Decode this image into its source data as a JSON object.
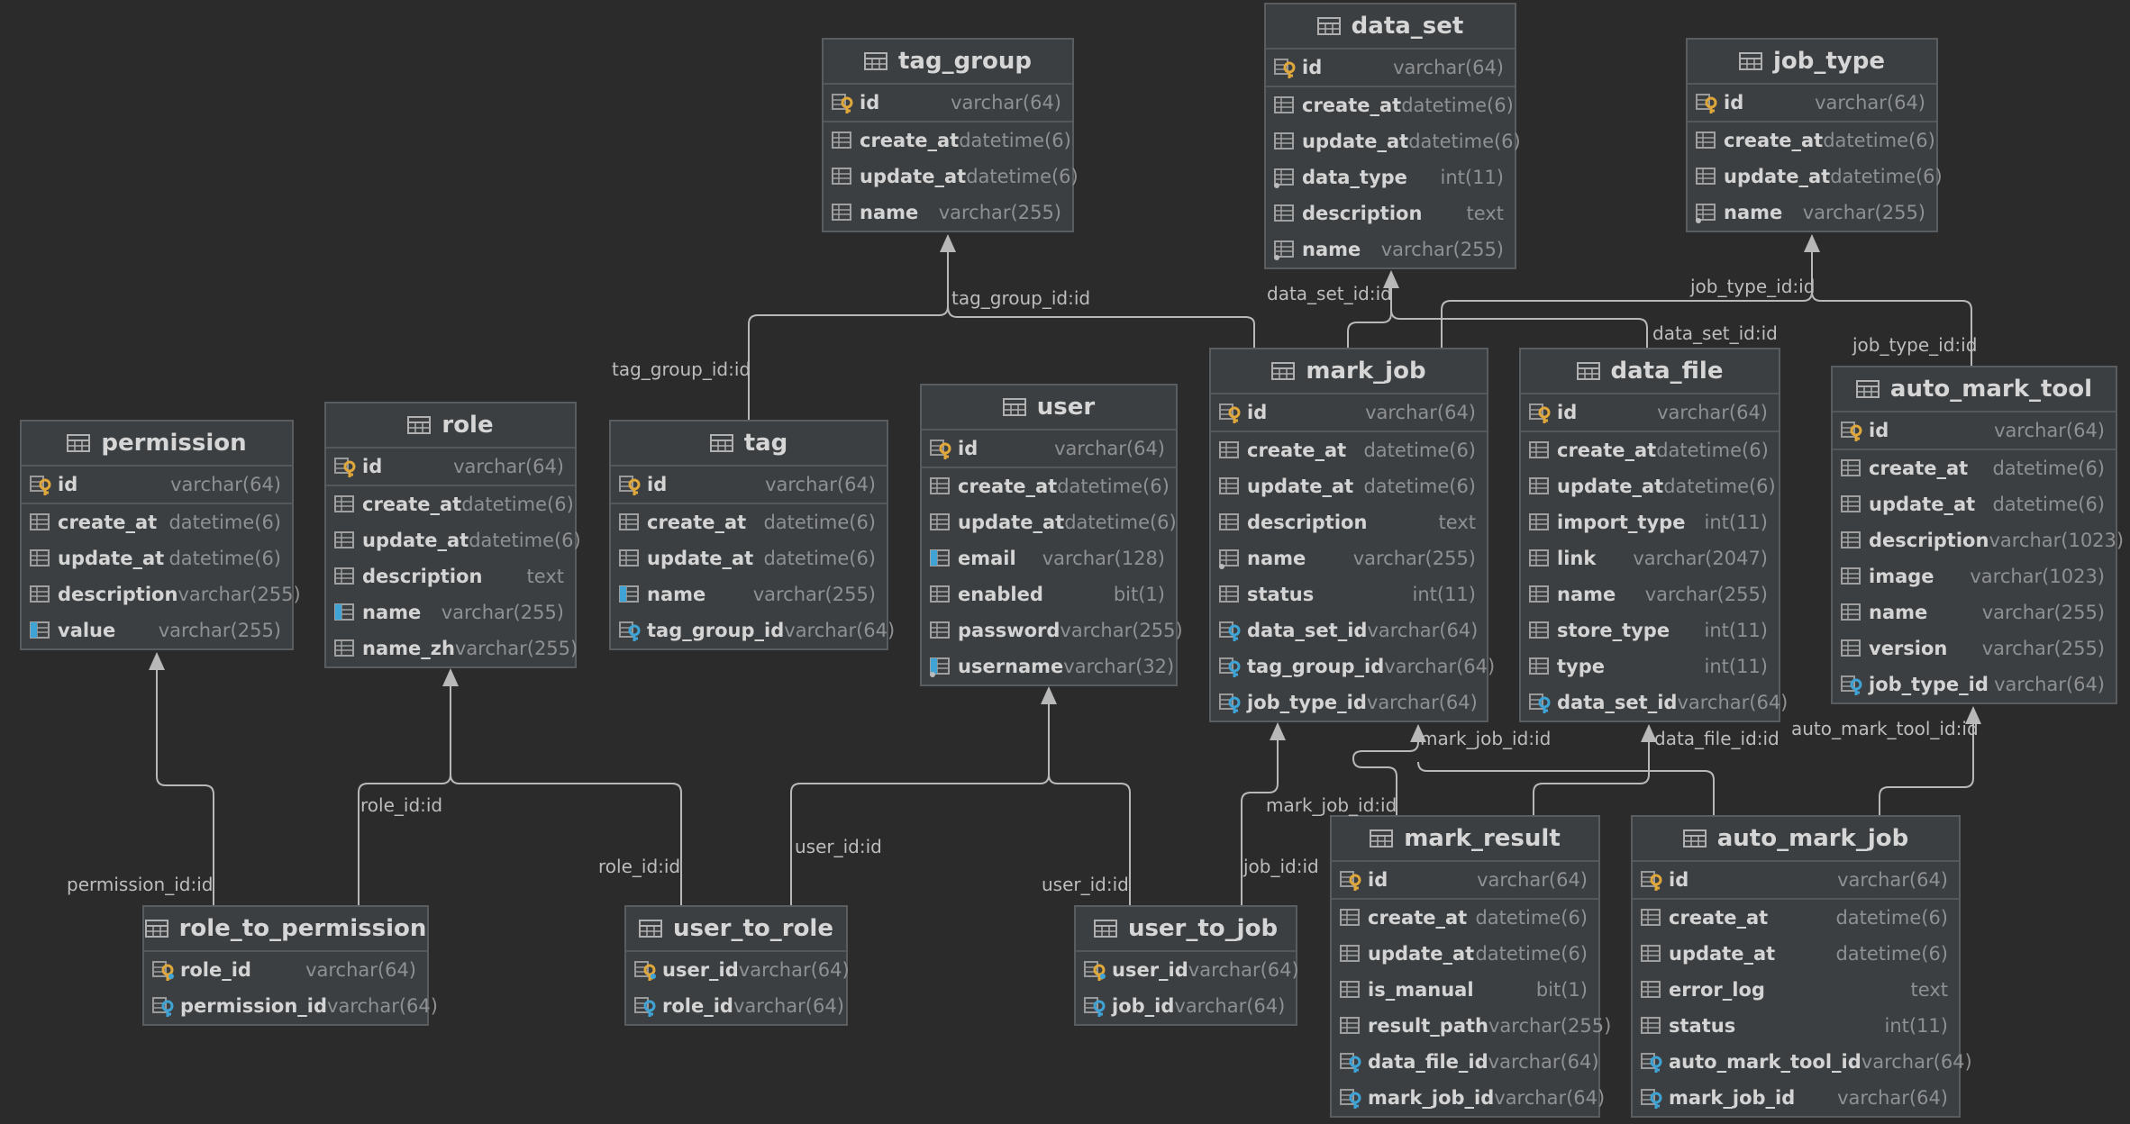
{
  "colors": {
    "background": "#2b2b2b",
    "table_bg": "#3c3f41",
    "table_border": "#5a5d60",
    "key_yellow": "#e0a83b",
    "key_blue": "#3fa3d6",
    "line": "#b8b8b8"
  },
  "tables": [
    {
      "name": "tag_group",
      "columns": [
        {
          "name": "id",
          "type": "varchar(64)",
          "kind": "pk"
        },
        {
          "name": "create_at",
          "type": "datetime(6)",
          "kind": "col"
        },
        {
          "name": "update_at",
          "type": "datetime(6)",
          "kind": "col"
        },
        {
          "name": "name",
          "type": "varchar(255)",
          "kind": "col"
        }
      ]
    },
    {
      "name": "data_set",
      "columns": [
        {
          "name": "id",
          "type": "varchar(64)",
          "kind": "pk"
        },
        {
          "name": "create_at",
          "type": "datetime(6)",
          "kind": "col"
        },
        {
          "name": "update_at",
          "type": "datetime(6)",
          "kind": "col"
        },
        {
          "name": "data_type",
          "type": "int(11)",
          "kind": "col-null"
        },
        {
          "name": "description",
          "type": "text",
          "kind": "col"
        },
        {
          "name": "name",
          "type": "varchar(255)",
          "kind": "col-null"
        }
      ]
    },
    {
      "name": "job_type",
      "columns": [
        {
          "name": "id",
          "type": "varchar(64)",
          "kind": "pk"
        },
        {
          "name": "create_at",
          "type": "datetime(6)",
          "kind": "col"
        },
        {
          "name": "update_at",
          "type": "datetime(6)",
          "kind": "col"
        },
        {
          "name": "name",
          "type": "varchar(255)",
          "kind": "col-null"
        }
      ]
    },
    {
      "name": "permission",
      "columns": [
        {
          "name": "id",
          "type": "varchar(64)",
          "kind": "pk"
        },
        {
          "name": "create_at",
          "type": "datetime(6)",
          "kind": "col"
        },
        {
          "name": "update_at",
          "type": "datetime(6)",
          "kind": "col"
        },
        {
          "name": "description",
          "type": "varchar(255)",
          "kind": "col"
        },
        {
          "name": "value",
          "type": "varchar(255)",
          "kind": "uniq"
        }
      ]
    },
    {
      "name": "role",
      "columns": [
        {
          "name": "id",
          "type": "varchar(64)",
          "kind": "pk"
        },
        {
          "name": "create_at",
          "type": "datetime(6)",
          "kind": "col"
        },
        {
          "name": "update_at",
          "type": "datetime(6)",
          "kind": "col"
        },
        {
          "name": "description",
          "type": "text",
          "kind": "col"
        },
        {
          "name": "name",
          "type": "varchar(255)",
          "kind": "uniq"
        },
        {
          "name": "name_zh",
          "type": "varchar(255)",
          "kind": "col"
        }
      ]
    },
    {
      "name": "tag",
      "columns": [
        {
          "name": "id",
          "type": "varchar(64)",
          "kind": "pk"
        },
        {
          "name": "create_at",
          "type": "datetime(6)",
          "kind": "col"
        },
        {
          "name": "update_at",
          "type": "datetime(6)",
          "kind": "col"
        },
        {
          "name": "name",
          "type": "varchar(255)",
          "kind": "uniq"
        },
        {
          "name": "tag_group_id",
          "type": "varchar(64)",
          "kind": "fk"
        }
      ]
    },
    {
      "name": "user",
      "columns": [
        {
          "name": "id",
          "type": "varchar(64)",
          "kind": "pk"
        },
        {
          "name": "create_at",
          "type": "datetime(6)",
          "kind": "col"
        },
        {
          "name": "update_at",
          "type": "datetime(6)",
          "kind": "col"
        },
        {
          "name": "email",
          "type": "varchar(128)",
          "kind": "uniq"
        },
        {
          "name": "enabled",
          "type": "bit(1)",
          "kind": "col"
        },
        {
          "name": "password",
          "type": "varchar(255)",
          "kind": "col"
        },
        {
          "name": "username",
          "type": "varchar(32)",
          "kind": "uniq-null"
        }
      ]
    },
    {
      "name": "mark_job",
      "columns": [
        {
          "name": "id",
          "type": "varchar(64)",
          "kind": "pk"
        },
        {
          "name": "create_at",
          "type": "datetime(6)",
          "kind": "col"
        },
        {
          "name": "update_at",
          "type": "datetime(6)",
          "kind": "col"
        },
        {
          "name": "description",
          "type": "text",
          "kind": "col"
        },
        {
          "name": "name",
          "type": "varchar(255)",
          "kind": "col-null"
        },
        {
          "name": "status",
          "type": "int(11)",
          "kind": "col"
        },
        {
          "name": "data_set_id",
          "type": "varchar(64)",
          "kind": "fk"
        },
        {
          "name": "tag_group_id",
          "type": "varchar(64)",
          "kind": "fk"
        },
        {
          "name": "job_type_id",
          "type": "varchar(64)",
          "kind": "fk"
        }
      ]
    },
    {
      "name": "data_file",
      "columns": [
        {
          "name": "id",
          "type": "varchar(64)",
          "kind": "pk"
        },
        {
          "name": "create_at",
          "type": "datetime(6)",
          "kind": "col"
        },
        {
          "name": "update_at",
          "type": "datetime(6)",
          "kind": "col"
        },
        {
          "name": "import_type",
          "type": "int(11)",
          "kind": "col"
        },
        {
          "name": "link",
          "type": "varchar(2047)",
          "kind": "col"
        },
        {
          "name": "name",
          "type": "varchar(255)",
          "kind": "col"
        },
        {
          "name": "store_type",
          "type": "int(11)",
          "kind": "col"
        },
        {
          "name": "type",
          "type": "int(11)",
          "kind": "col"
        },
        {
          "name": "data_set_id",
          "type": "varchar(64)",
          "kind": "fk"
        }
      ]
    },
    {
      "name": "auto_mark_tool",
      "columns": [
        {
          "name": "id",
          "type": "varchar(64)",
          "kind": "pk"
        },
        {
          "name": "create_at",
          "type": "datetime(6)",
          "kind": "col"
        },
        {
          "name": "update_at",
          "type": "datetime(6)",
          "kind": "col"
        },
        {
          "name": "description",
          "type": "varchar(1023)",
          "kind": "col"
        },
        {
          "name": "image",
          "type": "varchar(1023)",
          "kind": "col"
        },
        {
          "name": "name",
          "type": "varchar(255)",
          "kind": "col"
        },
        {
          "name": "version",
          "type": "varchar(255)",
          "kind": "col"
        },
        {
          "name": "job_type_id",
          "type": "varchar(64)",
          "kind": "fk"
        }
      ]
    },
    {
      "name": "role_to_permission",
      "columns": [
        {
          "name": "role_id",
          "type": "varchar(64)",
          "kind": "pkfk"
        },
        {
          "name": "permission_id",
          "type": "varchar(64)",
          "kind": "fk"
        }
      ]
    },
    {
      "name": "user_to_role",
      "columns": [
        {
          "name": "user_id",
          "type": "varchar(64)",
          "kind": "pkfk"
        },
        {
          "name": "role_id",
          "type": "varchar(64)",
          "kind": "fk"
        }
      ]
    },
    {
      "name": "user_to_job",
      "columns": [
        {
          "name": "user_id",
          "type": "varchar(64)",
          "kind": "pkfk"
        },
        {
          "name": "job_id",
          "type": "varchar(64)",
          "kind": "fk"
        }
      ]
    },
    {
      "name": "mark_result",
      "columns": [
        {
          "name": "id",
          "type": "varchar(64)",
          "kind": "pk"
        },
        {
          "name": "create_at",
          "type": "datetime(6)",
          "kind": "col"
        },
        {
          "name": "update_at",
          "type": "datetime(6)",
          "kind": "col"
        },
        {
          "name": "is_manual",
          "type": "bit(1)",
          "kind": "col"
        },
        {
          "name": "result_path",
          "type": "varchar(255)",
          "kind": "col"
        },
        {
          "name": "data_file_id",
          "type": "varchar(64)",
          "kind": "fk"
        },
        {
          "name": "mark_job_id",
          "type": "varchar(64)",
          "kind": "fk"
        }
      ]
    },
    {
      "name": "auto_mark_job",
      "columns": [
        {
          "name": "id",
          "type": "varchar(64)",
          "kind": "pk"
        },
        {
          "name": "create_at",
          "type": "datetime(6)",
          "kind": "col"
        },
        {
          "name": "update_at",
          "type": "datetime(6)",
          "kind": "col"
        },
        {
          "name": "error_log",
          "type": "text",
          "kind": "col"
        },
        {
          "name": "status",
          "type": "int(11)",
          "kind": "col"
        },
        {
          "name": "auto_mark_tool_id",
          "type": "varchar(64)",
          "kind": "fk"
        },
        {
          "name": "mark_job_id",
          "type": "varchar(64)",
          "kind": "fk"
        }
      ]
    }
  ],
  "relations": [
    "tag_group_id:id",
    "tag_group_id:id",
    "data_set_id:id",
    "data_set_id:id",
    "job_type_id:id",
    "job_type_id:id",
    "permission_id:id",
    "role_id:id",
    "role_id:id",
    "user_id:id",
    "user_id:id",
    "job_id:id",
    "mark_job_id:id",
    "mark_job_id:id",
    "data_file_id:id",
    "auto_mark_tool_id:id"
  ]
}
